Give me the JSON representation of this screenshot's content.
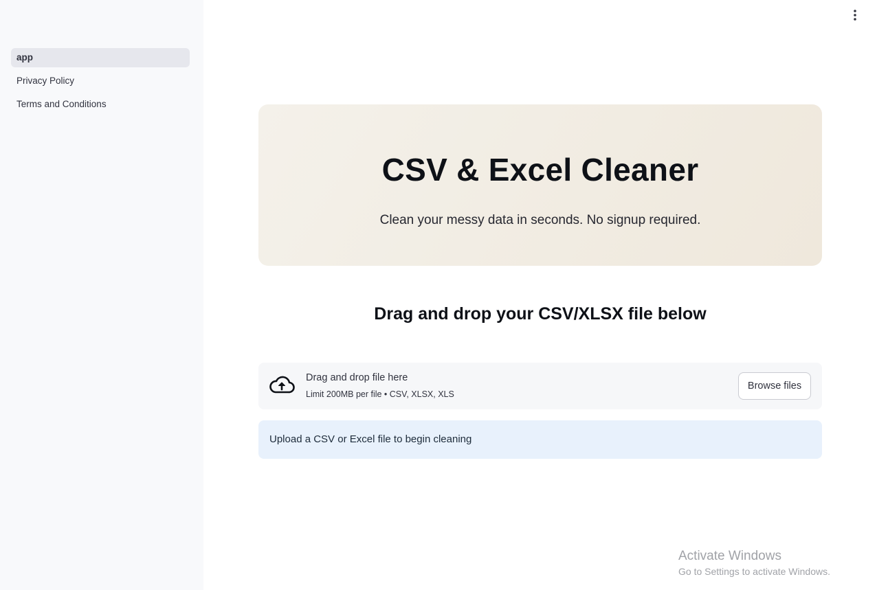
{
  "sidebar": {
    "items": [
      {
        "label": "app",
        "active": true
      },
      {
        "label": "Privacy Policy",
        "active": false
      },
      {
        "label": "Terms and Conditions",
        "active": false
      }
    ]
  },
  "header": {
    "menu_icon": "vertical-ellipsis-icon"
  },
  "hero": {
    "title": "CSV & Excel Cleaner",
    "subtitle": "Clean your messy data in seconds. No signup required."
  },
  "section": {
    "title": "Drag and drop your CSV/XLSX file below"
  },
  "uploader": {
    "icon": "cloud-upload-icon",
    "drop_text": "Drag and drop file here",
    "limit_text": "Limit 200MB per file • CSV, XLSX, XLS",
    "browse_label": "Browse files"
  },
  "info": {
    "message": "Upload a CSV or Excel file to begin cleaning"
  },
  "watermark": {
    "title": "Activate Windows",
    "subtitle": "Go to Settings to activate Windows."
  },
  "colors": {
    "sidebar_bg": "#f8f9fb",
    "active_item_bg": "#e6e7ed",
    "hero_bg": "#f2ede3",
    "info_bg": "#e8f1fc"
  }
}
